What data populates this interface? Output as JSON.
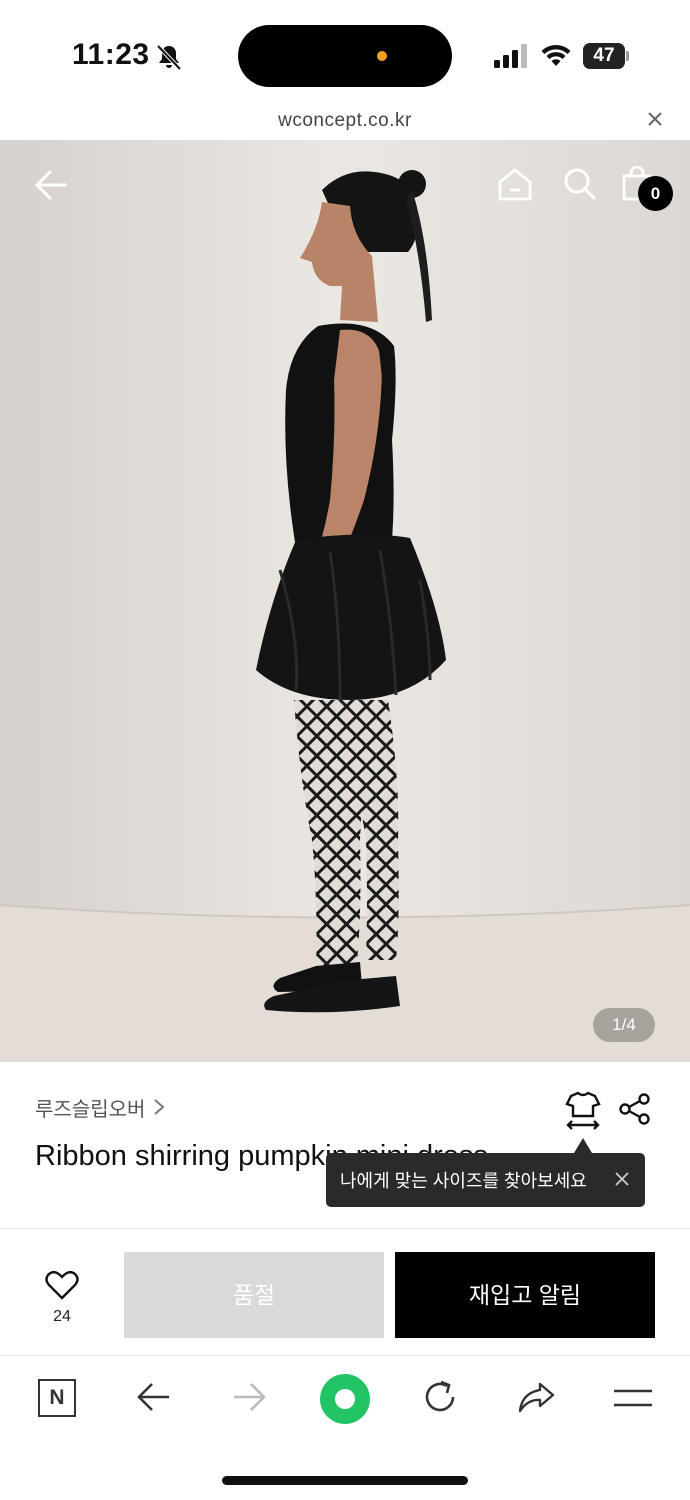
{
  "status_bar": {
    "time": "11:23",
    "battery": "47"
  },
  "browser": {
    "url": "wconcept.co.kr"
  },
  "header": {
    "cart_count": "0",
    "icons": [
      "back-arrow-icon",
      "home-icon",
      "search-icon",
      "shopping-bag-icon"
    ]
  },
  "gallery": {
    "page_indicator": "1/4"
  },
  "product": {
    "brand": "루즈슬립오버",
    "title": "Ribbon shirring pumpkin mini dress",
    "size_tooltip": "나에게 맞는 사이즈를 찾아보세요"
  },
  "actions": {
    "like_count": "24",
    "soldout_label": "품절",
    "restock_label": "재입고 알림"
  },
  "toolbar": {
    "n_label": "N",
    "accent_color": "#22c466"
  }
}
